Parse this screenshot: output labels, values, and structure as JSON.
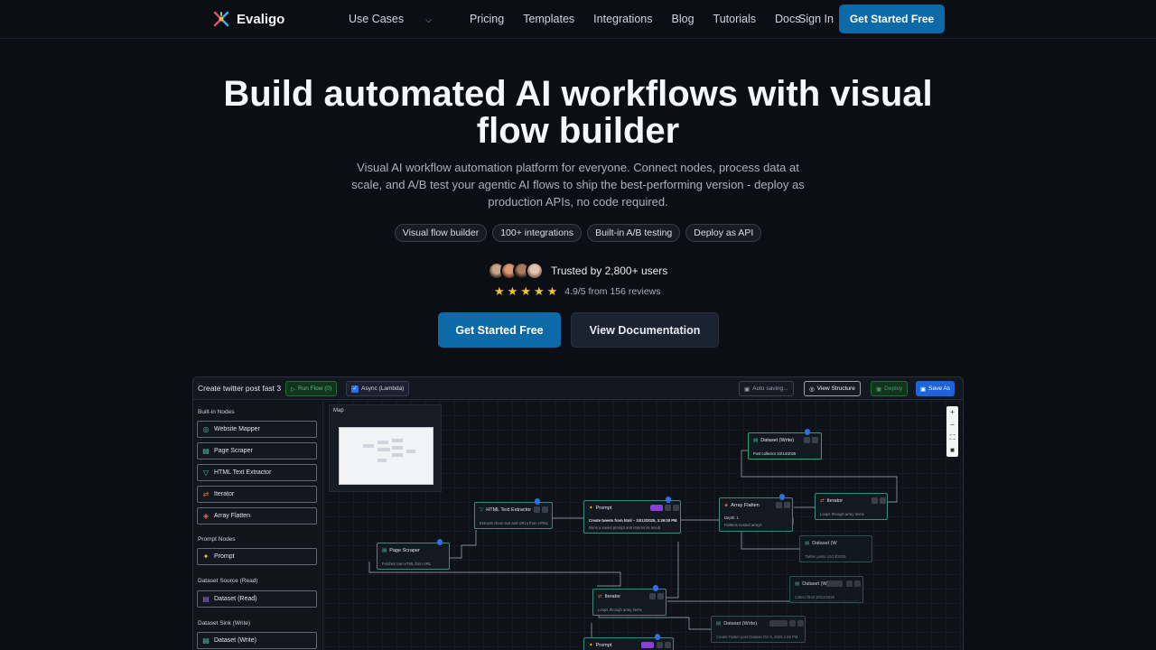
{
  "nav": {
    "brand": "Evaligo",
    "links": [
      "Use Cases",
      "Pricing",
      "Templates",
      "Integrations",
      "Blog",
      "Tutorials",
      "Docs"
    ],
    "signin": "Sign In",
    "cta": "Get Started Free"
  },
  "hero": {
    "title_line1": "Build automated AI workflows with visual",
    "title_line2": "flow builder",
    "subtitle": "Visual AI workflow automation platform for everyone. Connect nodes, process data at scale, and A/B test your agentic AI flows to ship the best-performing version - deploy as production APIs, no code required.",
    "chips": [
      "Visual flow builder",
      "100+ integrations",
      "Built-in A/B testing",
      "Deploy as API"
    ],
    "trusted": "Trusted by 2,800+ users",
    "rating": "4.9/5 from 156 reviews",
    "primary_cta": "Get Started Free",
    "secondary_cta": "View Documentation"
  },
  "app": {
    "title": "Create twitter post fast 3",
    "run": "Run Flow (0)",
    "async": "Async (Lambda)",
    "autosave": "Auto saving...",
    "view_structure": "View Structure",
    "deploy": "Deploy",
    "save_as": "Save As",
    "sidebar": {
      "section_builtin": "Built-in Nodes",
      "builtin_items": [
        "Website Mapper",
        "Page Scraper",
        "HTML Text Extractor",
        "Iterator",
        "Array Flatten"
      ],
      "section_prompt": "Prompt Nodes",
      "prompt_items": [
        "Prompt"
      ],
      "section_source": "Dataset Source (Read)",
      "source_items": [
        "Dataset (Read)"
      ],
      "section_sink": "Dataset Sink (Write)",
      "sink_items": [
        "Dataset (Write)"
      ]
    },
    "minimap_label": "Map",
    "nodes": {
      "page_scraper": {
        "title": "Page Scraper",
        "desc": "Fetches raw HTML from URL"
      },
      "html_extractor": {
        "title": "HTML Text Extractor",
        "desc": "Extracts clean text and URLs from HTML"
      },
      "prompt1": {
        "title": "Prompt",
        "desc1": "Create tweets from html – 10/13/2025, 3:39:00 PM",
        "desc2": "Runs a saved prompt and returns its result"
      },
      "array_flatten": {
        "title": "Array Flatten",
        "desc1": "Depth: 1",
        "desc2": "Flattens nested arrays"
      },
      "iterator_top": {
        "title": "Iterator",
        "desc": "Loops through array items"
      },
      "dataset_write_top": {
        "title": "Dataset (Write)",
        "desc": "Post collector 10/14/2025"
      },
      "dataset_mid": {
        "title": "Dataset (W",
        "desc": "Twitter posts 10/13/2025"
      },
      "dataset_mid2": {
        "title": "Dataset (W",
        "desc": "Collect html 10/13/2025"
      },
      "iterator_bottom": {
        "title": "Iterator",
        "desc": "Loops through array items"
      },
      "dataset_write_bottom": {
        "title": "Dataset (Write)",
        "desc": "Create Twitter post Dataset Oct 8, 2025 2:28 PM"
      },
      "prompt2": {
        "title": "Prompt"
      }
    }
  }
}
